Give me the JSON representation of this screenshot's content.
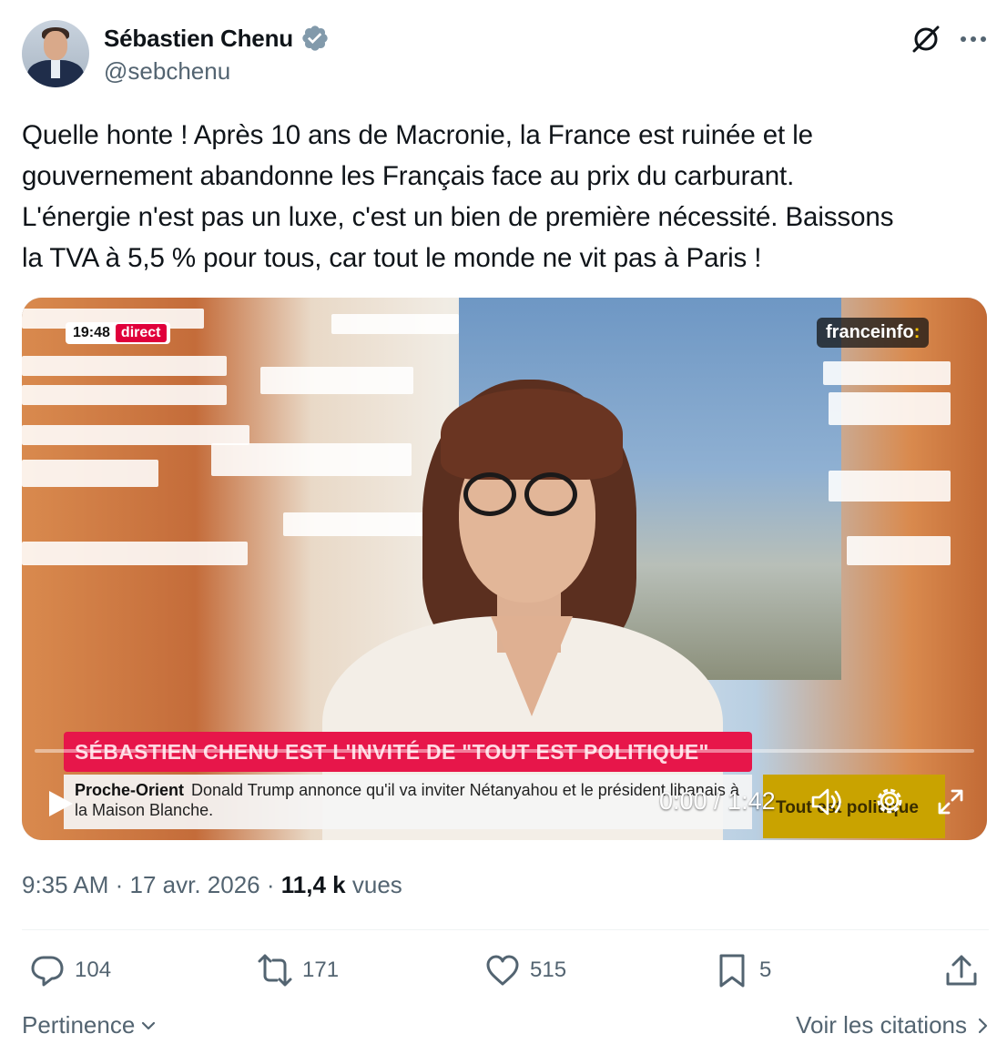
{
  "author": {
    "display_name": "Sébastien Chenu",
    "handle": "@sebchenu",
    "verified": true,
    "avatar_icon": "profile-photo"
  },
  "tweet": {
    "text": "Quelle honte ! Après 10 ans de Macronie, la France est ruinée et le\ngouvernement abandonne les Français face au prix du carburant.\nL'énergie n'est pas un luxe, c'est un bien de première nécessité. Baissons\nla TVA à 5,5 % pour tous, car tout le monde ne vit pas à Paris !"
  },
  "video": {
    "badge_time": "19:48",
    "badge_live": "direct",
    "channel_logo": "franceinfo",
    "channel_logo_suffix": ":",
    "banner": "SÉBASTIEN CHENU EST L'INVITÉ DE \"TOUT EST POLITIQUE\"",
    "ticker_topic": "Proche-Orient",
    "ticker_text": "Donald Trump annonce qu'il va inviter Nétanyahou et le président libanais à la Maison Blanche.",
    "show_logo": "Tout est politique",
    "time_readout": "0:00 / 1:42",
    "progress_fraction": 0,
    "controls": [
      "play-icon",
      "volume-icon",
      "settings-icon",
      "fullscreen-icon"
    ]
  },
  "meta": {
    "time": "9:35 AM",
    "date": "17 avr. 2026",
    "views_count": "11,4 k",
    "views_label": "vues"
  },
  "actions": {
    "replies": "104",
    "reposts": "171",
    "likes": "515",
    "bookmarks": "5"
  },
  "footer": {
    "sort_label": "Pertinence",
    "quotes_label": "Voir les citations"
  },
  "colors": {
    "text": "#0f1419",
    "secondary": "#536471",
    "verified": "#829aab",
    "accent": "#1d9bf0",
    "live_red": "#e0003b",
    "banner_red": "#e7164a"
  }
}
